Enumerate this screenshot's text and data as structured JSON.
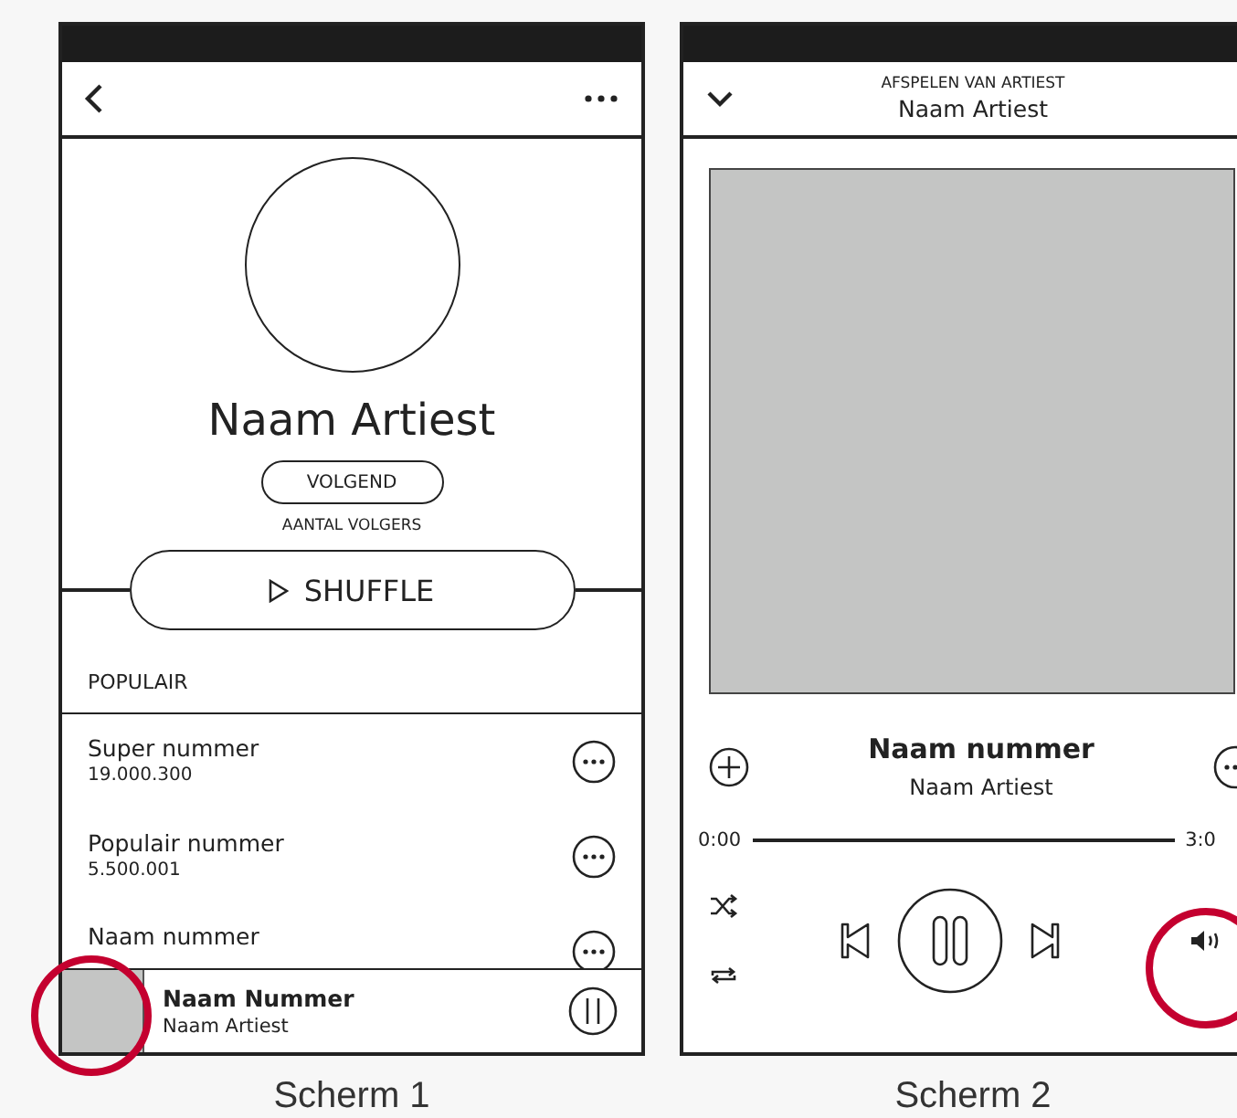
{
  "artist_screen": {
    "artist_name": "Naam Artiest",
    "follow_button": "VOLGEND",
    "followers_label": "AANTAL VOLGERS",
    "shuffle_button": "SHUFFLE",
    "section_title": "POPULAIR",
    "tracks": [
      {
        "title": "Super nummer",
        "plays": "19.000.300"
      },
      {
        "title": "Populair nummer",
        "plays": "5.500.001"
      },
      {
        "title": "Naam nummer"
      }
    ],
    "mini_player": {
      "title": "Naam Nummer",
      "artist": "Naam Artiest",
      "playing": true
    },
    "caption": "Scherm 1"
  },
  "player_screen": {
    "context_label": "AFSPELEN VAN ARTIEST",
    "context_name": "Naam Artiest",
    "track_title": "Naam nummer",
    "track_artist": "Naam Artiest",
    "elapsed": "0:00",
    "duration": "3:0",
    "playing": true,
    "caption": "Scherm 2"
  }
}
